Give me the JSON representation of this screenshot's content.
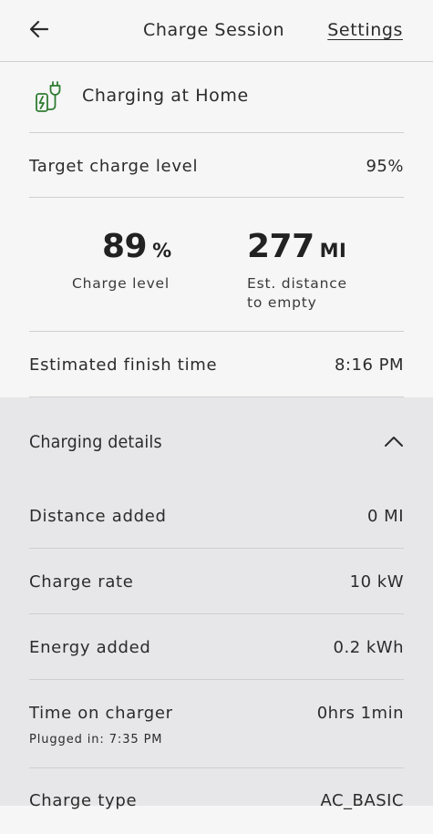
{
  "header": {
    "title": "Charge Session",
    "settings_label": "Settings",
    "back_icon": "arrow-left-icon"
  },
  "location": {
    "icon": "charging-plug-icon",
    "label": "Charging at Home",
    "icon_color": "#2f7d32"
  },
  "target": {
    "label": "Target charge level",
    "value": "95%"
  },
  "stats": {
    "charge": {
      "value": "89",
      "unit": "%",
      "label": "Charge level"
    },
    "distance": {
      "value": "277",
      "unit": "MI",
      "label_line1": "Est. distance",
      "label_line2": "to empty"
    }
  },
  "finish": {
    "label": "Estimated finish time",
    "value": "8:16 PM"
  },
  "details": {
    "title": "Charging details",
    "toggle_icon": "chevron-up-icon",
    "rows": [
      {
        "label": "Distance added",
        "value": "0 MI"
      },
      {
        "label": "Charge rate",
        "value": "10 kW"
      },
      {
        "label": "Energy added",
        "value": "0.2 kWh"
      },
      {
        "label": "Time on charger",
        "value": "0hrs 1min",
        "sub": "Plugged in: 7:35 PM"
      },
      {
        "label": "Charge type",
        "value": "AC_BASIC"
      }
    ]
  }
}
